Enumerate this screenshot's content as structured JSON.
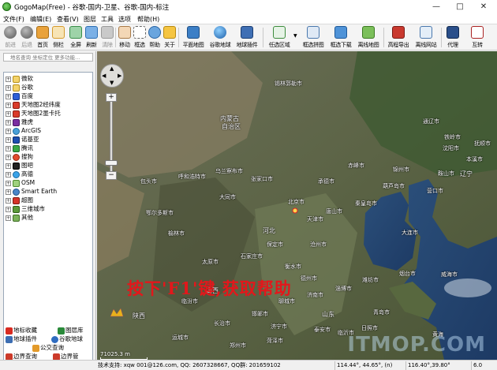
{
  "window": {
    "title": "GogoMap(Free) - 谷歌-国内-卫星、谷歌-国内-标注"
  },
  "menu": [
    "文件(F)",
    "编辑(E)",
    "查看(V)",
    "图层",
    "工具",
    "选项",
    "帮助(H)"
  ],
  "toolbar": {
    "back": "前进",
    "forward": "后退",
    "home": "首页",
    "sidebar": "侧栏",
    "fullscreen": "全屏",
    "refresh": "刷新",
    "clear": "清除",
    "move": "移动",
    "select": "框选",
    "help": "帮助",
    "about": "关于",
    "flatmap": "平面地图",
    "google_earth": "谷歌地球",
    "earth_plugin": "地球插件",
    "area": "任选区域",
    "draw_mosaic": "框选拼图",
    "draw_download": "框选下载",
    "offline_map": "离线地图",
    "elevation": "高程导出",
    "offline_site": "离线网站",
    "proxy": "代理",
    "convert": "互转"
  },
  "search": {
    "placeholder": "地名查询 坐标定位 更多功能..."
  },
  "tree": [
    "微软",
    "谷歌",
    "百度",
    "天地图2经纬度",
    "天地图2墨卡托",
    "雅虎",
    "ArcGIS",
    "诺基亚",
    "腾讯",
    "搜狗",
    "图吧",
    "高德",
    "OSM",
    "Smart Earth",
    "超图",
    "三维城市",
    "其他"
  ],
  "panel_tabs": {
    "fav": "地标收藏",
    "library": "图层库",
    "plugin": "地球插件",
    "google_earth": "谷歌地球",
    "bus": "公交查询",
    "route_left": "边界查询",
    "route_right": "边界管"
  },
  "map": {
    "help_text": "按下'F1'键,获取帮助",
    "scale": "71025.3 m",
    "watermark": "ITMOP.COM",
    "labels": {
      "xilinhaote": "锡林郭勒市",
      "neimenggu": "内蒙古",
      "zizhiqu": "自治区",
      "chifeng": "赤峰市",
      "tongliao": "通辽市",
      "tieling": "铁岭市",
      "shenyang": "沈阳市",
      "fushun": "抚顺市",
      "liaoning": "辽宁",
      "jinzhou": "锦州市",
      "anshan": "鞍山市",
      "yingkou": "营口市",
      "benxi": "本溪市",
      "hohhot": "呼和浩特市",
      "wulanchabu": "乌兰察布市",
      "zhangjiakou": "张家口市",
      "datong": "大同市",
      "baotou": "包头市",
      "beijing": "北京市",
      "chengde": "承德市",
      "qinhuangdao": "秦皇岛市",
      "huludao": "葫芦岛市",
      "tianjin": "天津市",
      "tangshan": "唐山市",
      "dalian": "大连市",
      "hebei": "河北",
      "baoding": "保定市",
      "cangzhou": "沧州市",
      "shijiazhuang": "石家庄市",
      "taiyuan": "太原市",
      "linfen": "临汾市",
      "shanxi": "山西",
      "hengshui": "衡水市",
      "dezhou": "德州市",
      "liaocheng": "聊城市",
      "jinan": "济南市",
      "zibo": "淄博市",
      "weifang": "潍坊市",
      "qingdao": "青岛市",
      "yantai": "烟台市",
      "weihai": "威海市",
      "yancheng": "延安市",
      "handan": "邯郸市",
      "shandong": "山东",
      "jining": "济宁市",
      "linyi": "临沂市",
      "rizhao": "日照市",
      "shaanxi": "陕西",
      "yulin": "榆林市",
      "changzhi": "长治市",
      "jincheng": "晋城市",
      "xinxiang": "新乡市",
      "zhengzhou": "郑州市",
      "kaifeng": "开封市",
      "xuzhou": "徐州市",
      "lianyungang": "连云港市",
      "huanghai": "黄海",
      "ordos": "鄂尔多斯市",
      "bayanzhuoer": "巴彦淖尔市",
      "wuhai": "乌海市",
      "dandong": "丹东市",
      "chaoyang": "朝阳市",
      "lvliang": "吕梁市",
      "yuncheng": "运城市",
      "xian": "西安市",
      "weinan": "渭南市",
      "luoyang": "洛阳市",
      "zaozhuang": "枣庄市",
      "taian": "泰安市",
      "binzhou": "滨州市",
      "dongying": "东营市",
      "xingtai": "邢台市",
      "anyang": "安阳市",
      "puyang": "濮阳市",
      "heze": "菏泽市"
    }
  },
  "status": {
    "support": "技术支持: xqw 001@126.com, QQ: 2607328667, QQ群: 201659102",
    "coord1": "114.44°, 44.65°, (n)",
    "coord2": "116.40°,39.80°",
    "zoom": "6.0"
  }
}
